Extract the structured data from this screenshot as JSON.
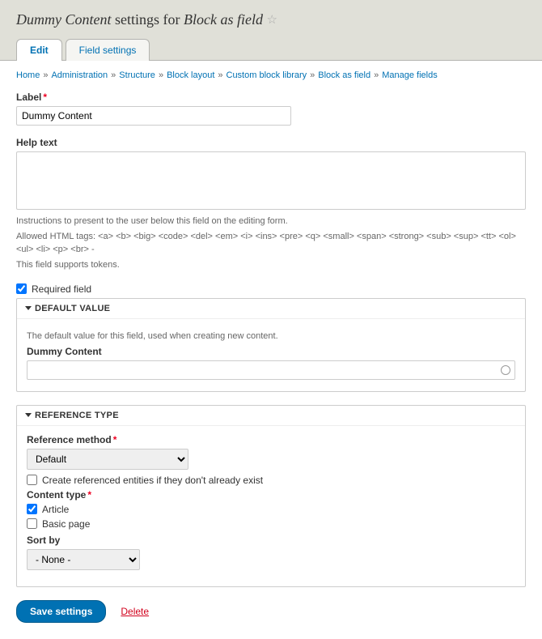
{
  "title": {
    "prefix": "Dummy Content",
    "middle": "settings for",
    "suffix": "Block as field"
  },
  "tabs": [
    {
      "label": "Edit",
      "active": true
    },
    {
      "label": "Field settings",
      "active": false
    }
  ],
  "breadcrumb": [
    "Home",
    "Administration",
    "Structure",
    "Block layout",
    "Custom block library",
    "Block as field",
    "Manage fields"
  ],
  "label": {
    "text": "Label",
    "value": "Dummy Content"
  },
  "help": {
    "label": "Help text",
    "value": "",
    "desc1": "Instructions to present to the user below this field on the editing form.",
    "desc2": "Allowed HTML tags: <a> <b> <big> <code> <del> <em> <i> <ins> <pre> <q> <small> <span> <strong> <sub> <sup> <tt> <ol> <ul> <li> <p> <br> -",
    "desc3": "This field supports tokens."
  },
  "required": {
    "label": "Required field",
    "checked": true
  },
  "default_section": {
    "legend": "DEFAULT VALUE",
    "desc": "The default value for this field, used when creating new content.",
    "field_label": "Dummy Content",
    "value": ""
  },
  "reference_section": {
    "legend": "REFERENCE TYPE",
    "method_label": "Reference method",
    "method_value": "Default",
    "create_label": "Create referenced entities if they don't already exist",
    "create_checked": false,
    "content_type_label": "Content type",
    "content_types": [
      {
        "label": "Article",
        "checked": true
      },
      {
        "label": "Basic page",
        "checked": false
      }
    ],
    "sort_label": "Sort by",
    "sort_value": "- None -"
  },
  "actions": {
    "save": "Save settings",
    "delete": "Delete"
  }
}
